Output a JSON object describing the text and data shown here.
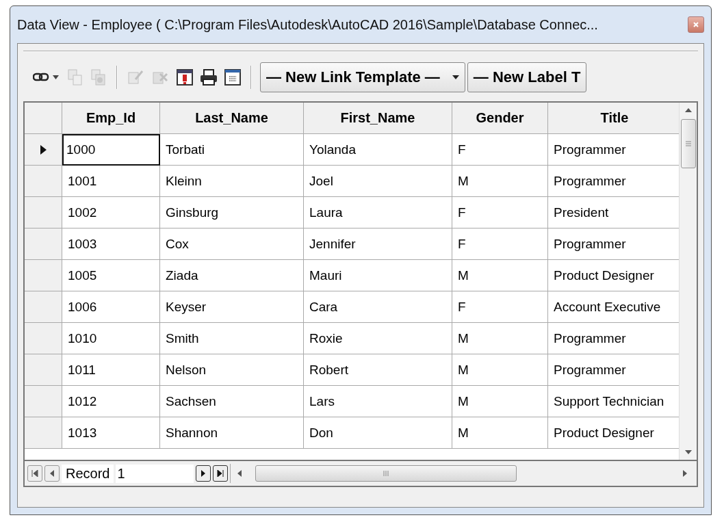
{
  "window": {
    "title": "Data View - Employee ( C:\\Program Files\\Autodesk\\AutoCAD 2016\\Sample\\Database Connec..."
  },
  "toolbar": {
    "buttons": [
      {
        "kind": "link",
        "disabled": false
      },
      {
        "kind": "copy",
        "disabled": true
      },
      {
        "kind": "copy-stack",
        "disabled": true
      },
      {
        "kind": "separator"
      },
      {
        "kind": "mark",
        "disabled": true
      },
      {
        "kind": "unmark",
        "disabled": true
      },
      {
        "kind": "form",
        "disabled": false
      },
      {
        "kind": "print",
        "disabled": false
      },
      {
        "kind": "grid",
        "disabled": false
      }
    ],
    "dropdowns": [
      "— New Link Template —",
      "— New Label T"
    ]
  },
  "table": {
    "columns": [
      "Emp_Id",
      "Last_Name",
      "First_Name",
      "Gender",
      "Title"
    ],
    "rows": [
      {
        "selected": true,
        "cells": [
          "1000",
          "Torbati",
          "Yolanda",
          "F",
          "Programmer"
        ]
      },
      {
        "selected": false,
        "cells": [
          "1001",
          "Kleinn",
          "Joel",
          "M",
          "Programmer"
        ]
      },
      {
        "selected": false,
        "cells": [
          "1002",
          "Ginsburg",
          "Laura",
          "F",
          "President"
        ]
      },
      {
        "selected": false,
        "cells": [
          "1003",
          "Cox",
          "Jennifer",
          "F",
          "Programmer"
        ]
      },
      {
        "selected": false,
        "cells": [
          "1005",
          "Ziada",
          "Mauri",
          "M",
          "Product Designer"
        ]
      },
      {
        "selected": false,
        "cells": [
          "1006",
          "Keyser",
          "Cara",
          "F",
          "Account Executive"
        ]
      },
      {
        "selected": false,
        "cells": [
          "1010",
          "Smith",
          "Roxie",
          "M",
          "Programmer"
        ]
      },
      {
        "selected": false,
        "cells": [
          "1011",
          "Nelson",
          "Robert",
          "M",
          "Programmer"
        ]
      },
      {
        "selected": false,
        "cells": [
          "1012",
          "Sachsen",
          "Lars",
          "M",
          "Support Technician"
        ]
      },
      {
        "selected": false,
        "cells": [
          "1013",
          "Shannon",
          "Don",
          "M",
          "Product Designer"
        ]
      }
    ]
  },
  "navigator": {
    "label": "Record",
    "value": "1"
  }
}
